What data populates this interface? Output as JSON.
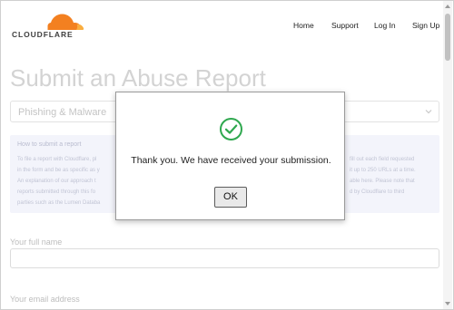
{
  "header": {
    "logo_text": "CLOUDFLARE",
    "nav": {
      "home": "Home",
      "support": "Support",
      "login": "Log In",
      "signup": "Sign Up"
    }
  },
  "page": {
    "title": "Submit an Abuse Report",
    "report_type_select": {
      "selected": "Phishing & Malware",
      "icon": "chevron-down-icon"
    },
    "info_box": {
      "heading": "How to submit a report",
      "lines_left": [
        "To file a report with Cloudflare, pl",
        "in the form and be as specific as y",
        "An explanation of our approach t",
        "reports submitted through this fo",
        "parties such as the Lumen Databa"
      ],
      "lines_right": [
        "fill out each field requested",
        "it up to 250 URLs at a time.",
        "able here. Please note that",
        "d by Cloudflare to third",
        ""
      ]
    },
    "fields": {
      "full_name_label": "Your full name",
      "email_label": "Your email address"
    }
  },
  "modal": {
    "icon": "checkmark-circle-icon",
    "message": "Thank you. We have received your submission.",
    "ok_label": "OK"
  },
  "colors": {
    "brand_orange": "#f38020",
    "success_green": "#2fa84f"
  }
}
